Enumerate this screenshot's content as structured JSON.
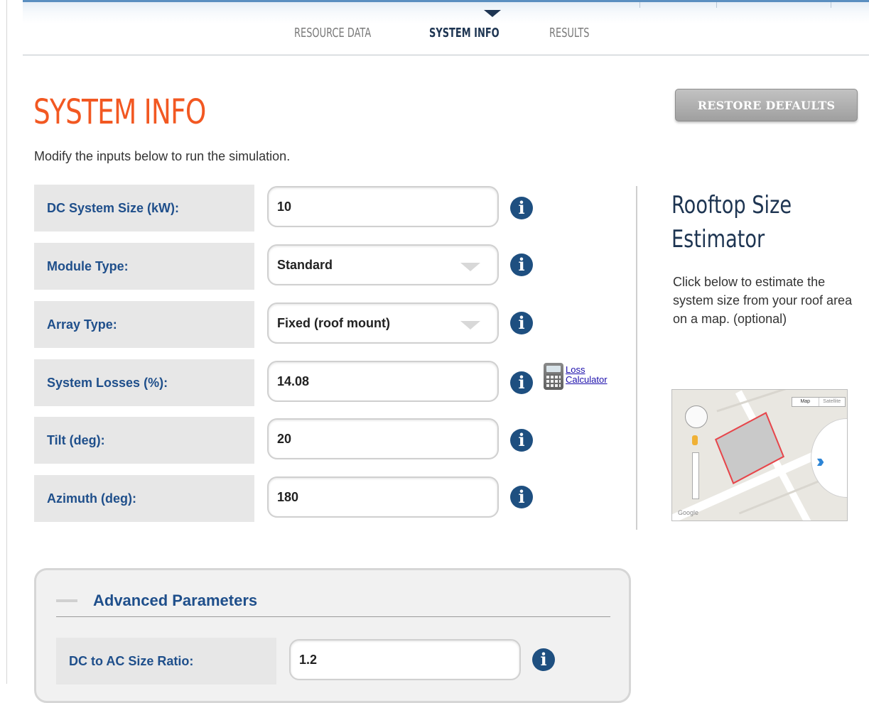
{
  "nav": {
    "tabs": [
      {
        "label": "RESOURCE DATA",
        "active": false
      },
      {
        "label": "SYSTEM INFO",
        "active": true
      },
      {
        "label": "RESULTS",
        "active": false
      }
    ]
  },
  "header": {
    "title": "SYSTEM INFO",
    "restore_label": "RESTORE DEFAULTS",
    "subtitle": "Modify the inputs below to run the simulation."
  },
  "fields": [
    {
      "label": "DC System Size (kW):",
      "value": "10",
      "type": "text"
    },
    {
      "label": "Module Type:",
      "value": "Standard",
      "type": "select"
    },
    {
      "label": "Array Type:",
      "value": "Fixed (roof mount)",
      "type": "select"
    },
    {
      "label": "System Losses (%):",
      "value": "14.08",
      "type": "text"
    },
    {
      "label": "Tilt (deg):",
      "value": "20",
      "type": "text"
    },
    {
      "label": "Azimuth (deg):",
      "value": "180",
      "type": "text"
    }
  ],
  "loss_calculator": {
    "line1": "Loss",
    "line2": "Calculator"
  },
  "sidebar": {
    "title_line1": "Rooftop Size",
    "title_line2": "Estimator",
    "description": "Click below to estimate the system size from your roof area on a map. (optional)",
    "map": {
      "type_map": "Map",
      "type_satellite": "Satellite",
      "attribution": "Google",
      "go_icon": "double-chevron-right-icon"
    }
  },
  "advanced": {
    "title": "Advanced Parameters",
    "fields": [
      {
        "label": "DC to AC Size Ratio:",
        "value": "1.2"
      }
    ]
  },
  "colors": {
    "accent_orange": "#f25822",
    "label_blue": "#1f4f8b",
    "navy": "#1e3552",
    "info_icon": "#1e4f80"
  },
  "icons": {
    "info": "info-icon",
    "calculator": "calculator-icon",
    "dropdown": "caret-down-icon"
  }
}
